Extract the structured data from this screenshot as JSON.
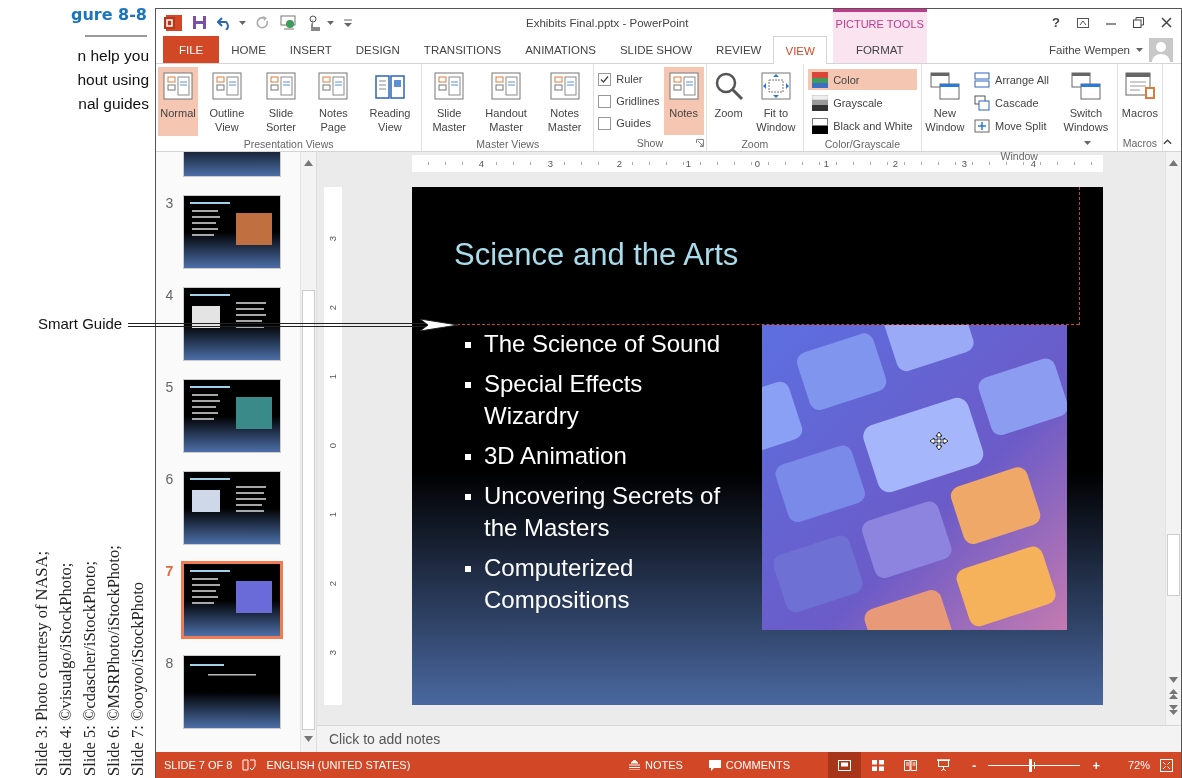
{
  "figure": {
    "label": "gure 8-8",
    "caption": [
      "n help you",
      "hout using",
      "nal guides"
    ],
    "callout": "Smart Guide",
    "credits": [
      "Slide 3: Photo courtesy of NASA;",
      "Slide 4: ©visualgo/iStockPhoto;",
      "Slide 5: ©cdascher/iStockPhoto;",
      "Slide 6: ©MSRPhoto/iStockPhoto;",
      "Slide 7: ©ooyoo/iStockPhoto"
    ]
  },
  "window": {
    "title": "Exhibits Final.pptx - PowerPoint",
    "context_label": "PICTURE TOOLS",
    "help": "?",
    "user": "Faithe Wempen"
  },
  "tabs": [
    {
      "label": "FILE",
      "kind": "file",
      "selected": false
    },
    {
      "label": "HOME",
      "kind": "tab",
      "selected": false
    },
    {
      "label": "INSERT",
      "kind": "tab",
      "selected": false
    },
    {
      "label": "DESIGN",
      "kind": "tab",
      "selected": false
    },
    {
      "label": "TRANSITIONS",
      "kind": "tab",
      "selected": false
    },
    {
      "label": "ANIMATIONS",
      "kind": "tab",
      "selected": false
    },
    {
      "label": "SLIDE SHOW",
      "kind": "tab",
      "selected": false
    },
    {
      "label": "REVIEW",
      "kind": "tab",
      "selected": false
    },
    {
      "label": "VIEW",
      "kind": "tab",
      "selected": true
    },
    {
      "label": "FORMAT",
      "kind": "contextual",
      "selected": false
    }
  ],
  "ribbon": [
    {
      "label": "Presentation Views",
      "items": [
        {
          "kind": "large",
          "label": "Normal",
          "selected": true
        },
        {
          "kind": "large",
          "label": "Outline View",
          "selected": false
        },
        {
          "kind": "large",
          "label": "Slide Sorter",
          "selected": false
        },
        {
          "kind": "large",
          "label": "Notes Page",
          "selected": false
        },
        {
          "kind": "large",
          "label": "Reading View",
          "selected": false
        }
      ]
    },
    {
      "label": "Master Views",
      "items": [
        {
          "kind": "large",
          "label": "Slide Master",
          "selected": false
        },
        {
          "kind": "large",
          "label": "Handout Master",
          "selected": false
        },
        {
          "kind": "large",
          "label": "Notes Master",
          "selected": false
        }
      ]
    },
    {
      "label": "Show",
      "launcher": true,
      "items": [
        {
          "kind": "check",
          "label": "Ruler",
          "checked": true
        },
        {
          "kind": "check",
          "label": "Gridlines",
          "checked": false
        },
        {
          "kind": "check",
          "label": "Guides",
          "checked": false
        },
        {
          "kind": "large",
          "label": "Notes",
          "selected": true
        }
      ]
    },
    {
      "label": "Zoom",
      "items": [
        {
          "kind": "large",
          "label": "Zoom",
          "selected": false
        },
        {
          "kind": "large",
          "label": "Fit to Window",
          "selected": false
        }
      ]
    },
    {
      "label": "Color/Grayscale",
      "items": [
        {
          "kind": "small",
          "label": "Color",
          "selected": true
        },
        {
          "kind": "small",
          "label": "Grayscale",
          "selected": false
        },
        {
          "kind": "small",
          "label": "Black and White",
          "selected": false
        }
      ]
    },
    {
      "label": "Window",
      "items": [
        {
          "kind": "large",
          "label": "New Window",
          "selected": false
        },
        {
          "kind": "small",
          "label": "Arrange All",
          "selected": false
        },
        {
          "kind": "small",
          "label": "Cascade",
          "selected": false
        },
        {
          "kind": "small",
          "label": "Move Split",
          "selected": false
        },
        {
          "kind": "large",
          "label": "Switch Windows",
          "selected": false,
          "dropdown": true
        }
      ]
    },
    {
      "label": "Macros",
      "items": [
        {
          "kind": "large",
          "label": "Macros",
          "selected": false
        }
      ]
    }
  ],
  "slides": [
    {
      "cut_off": true,
      "selected": false
    },
    {
      "number": "3",
      "selected": false
    },
    {
      "number": "4",
      "selected": false
    },
    {
      "number": "5",
      "selected": false
    },
    {
      "number": "6",
      "selected": false
    },
    {
      "number": "7",
      "selected": true
    },
    {
      "number": "8",
      "selected": false
    }
  ],
  "rulers": {
    "horizontal": [
      "4",
      "3",
      "2",
      "1",
      "0",
      "1",
      "2",
      "3",
      "4"
    ],
    "vertical": [
      "3",
      "2",
      "1",
      "0",
      "1",
      "2",
      "3"
    ]
  },
  "slide": {
    "title": "Science and the Arts",
    "bullets": [
      "The Science of Sound",
      "Special Effects Wizardry",
      "3D Animation",
      "Uncovering Secrets of the Masters",
      "Computerized Compositions"
    ]
  },
  "notes": {
    "placeholder": "Click to add notes"
  },
  "status_bar": {
    "slide": "SLIDE 7 OF 8",
    "language": "ENGLISH (UNITED STATES)",
    "notes": "NOTES",
    "comments": "COMMENTS",
    "views": [
      {
        "selected": true
      },
      {
        "selected": false
      },
      {
        "selected": false
      },
      {
        "selected": false
      }
    ],
    "zoom_out": "-",
    "zoom": {
      "level": 0.45
    },
    "zoom_in": "+",
    "zoom_percent": "72%"
  }
}
